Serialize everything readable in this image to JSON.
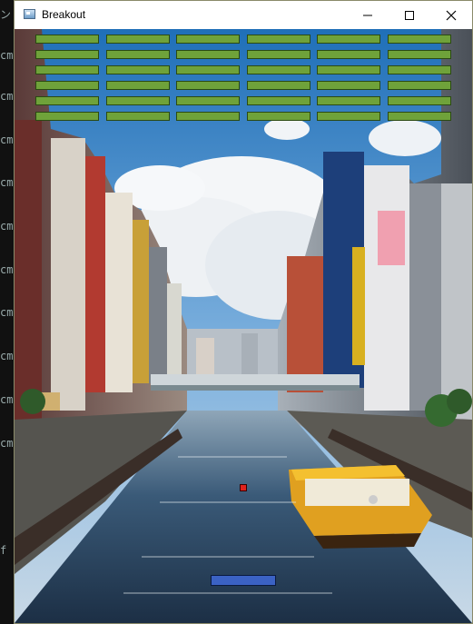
{
  "window": {
    "title": "Breakout",
    "minimize_icon": "minimize-icon",
    "maximize_icon": "maximize-icon",
    "close_icon": "close-icon"
  },
  "game": {
    "brick_rows": 6,
    "brick_cols": 6,
    "brick_color": "#6fa23a",
    "ball_color": "#e0221c",
    "paddle_color": "#3b62c4",
    "background_scene": "city canal photo"
  },
  "background_window": {
    "glyphs": [
      "ン",
      "cm",
      "cm",
      "cm",
      "cm",
      "cm",
      "cm",
      "cm",
      "cm",
      "cm",
      "cm",
      "f"
    ]
  }
}
